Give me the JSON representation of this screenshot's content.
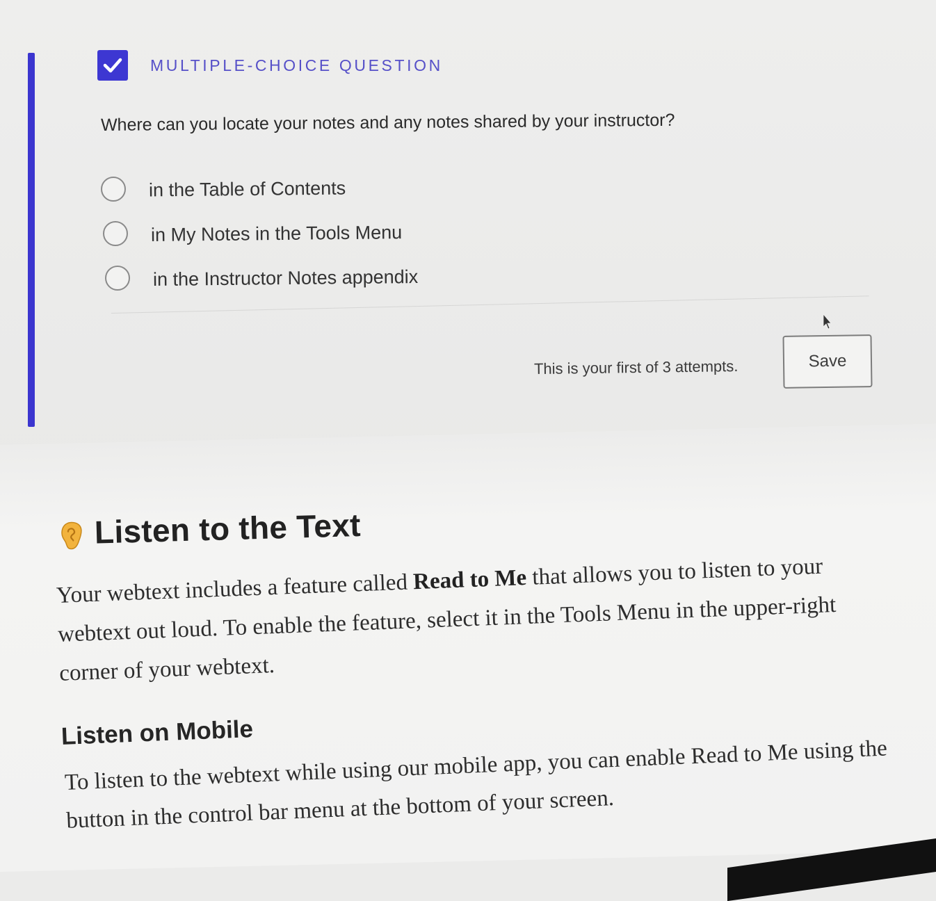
{
  "question_card": {
    "type_label": "MULTIPLE-CHOICE QUESTION",
    "question": "Where can you locate your notes and any notes shared by your instructor?",
    "options": [
      "in the Table of Contents",
      "in My Notes in the Tools Menu",
      "in the Instructor Notes appendix"
    ],
    "attempts_text": "This is your first of 3 attempts.",
    "save_label": "Save",
    "accent_color": "#3d37d2"
  },
  "listen_section": {
    "title": "Listen to the Text",
    "para_pre": "Your webtext includes a feature called ",
    "para_bold": "Read to Me",
    "para_post": " that allows you to listen to your webtext out loud. To enable the feature, select it in the Tools Menu in the upper-right corner of your webtext.",
    "subheading": "Listen on Mobile",
    "mobile_para": "To listen to the webtext while using our mobile app, you can enable Read to Me using the button in the control bar menu at the bottom of your screen."
  },
  "icons": {
    "question_type": "checkbox-check-icon",
    "section": "ear-icon",
    "pointer": "mouse-cursor-icon"
  }
}
